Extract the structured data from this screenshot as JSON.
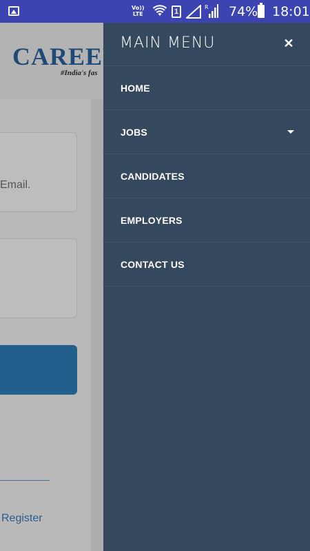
{
  "status_bar": {
    "left_icon": "image-icon",
    "volte_top": "Vo))",
    "volte_bottom": "LTE",
    "sim_slot": "1",
    "battery_percent": "74%",
    "time": "18:01"
  },
  "background_page": {
    "logo_text": "CAREER",
    "tagline": "#India's fas",
    "field_hint": "Email.",
    "register_link": "Register",
    "brand_color": "#1f4a78"
  },
  "drawer": {
    "title": "MAIN MENU",
    "close_icon": "close-icon",
    "background_color": "#34495e",
    "items": [
      {
        "label": "HOME"
      },
      {
        "label": "JOBS",
        "has_dropdown": true
      },
      {
        "label": "CANDIDATES"
      },
      {
        "label": "EMPLOYERS"
      },
      {
        "label": "CONTACT US"
      }
    ]
  }
}
